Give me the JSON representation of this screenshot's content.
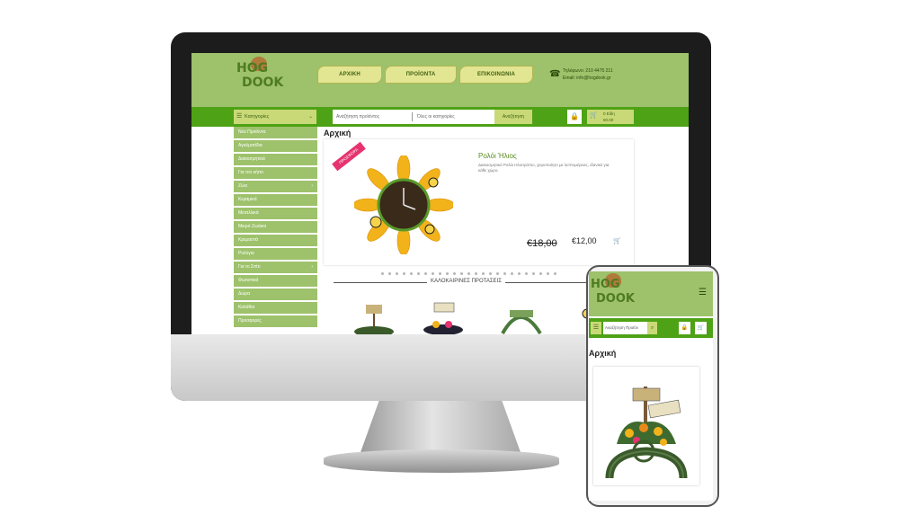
{
  "site": {
    "logo_line1": "HOG",
    "logo_line2": "DOOK",
    "phone_line1": "Τηλέφωνο: 210 4475 211",
    "phone_line2": "Email: info@hogdook.gr"
  },
  "nav": [
    {
      "label": "ΑΡΧΙΚΗ"
    },
    {
      "label": "ΠΡΟΪΟΝΤΑ"
    },
    {
      "label": "ΕΠΙΚΟΙΝΩΝΙΑ"
    }
  ],
  "toolbar": {
    "categories_label": "Κατηγορίες",
    "search_placeholder_1": "Αναζήτηση προϊόντος",
    "search_placeholder_2": "Όλες οι κατηγορίες",
    "search_button": "Αναζήτηση",
    "cart_line1": "0 Είδη",
    "cart_line2": "€0.00"
  },
  "sidebar": {
    "items": [
      {
        "label": "Νέα Προϊόντα",
        "arrow": ""
      },
      {
        "label": "Αγαλματίδια",
        "arrow": ""
      },
      {
        "label": "Διακοσμητικά",
        "arrow": ""
      },
      {
        "label": "Για τον κήπο",
        "arrow": ""
      },
      {
        "label": "Ζώα",
        "arrow": "›"
      },
      {
        "label": "Κεραμικά",
        "arrow": ""
      },
      {
        "label": "Μεταλλικά",
        "arrow": ""
      },
      {
        "label": "Μικρά Ζωάκια",
        "arrow": ""
      },
      {
        "label": "Κρεμαστά",
        "arrow": ""
      },
      {
        "label": "Ρολόγια",
        "arrow": ""
      },
      {
        "label": "Για το Σπίτι",
        "arrow": "›"
      },
      {
        "label": "Φωτιστικά",
        "arrow": ""
      },
      {
        "label": "Δώρα",
        "arrow": ""
      },
      {
        "label": "Καλάθια",
        "arrow": ""
      },
      {
        "label": "Προσφορές",
        "arrow": ""
      }
    ]
  },
  "content": {
    "page_title": "Αρχική",
    "badge": "ΠΡΟΣΦΟΡΑ",
    "product_title": "Ρολόι Ήλιος",
    "product_desc": "Διακοσμητικό Ρολόι Ηλιοτρόπιο, χειροποίητο με λεπτομέρειες, ιδανικό για κάθε χώρο.",
    "old_price": "€18,00",
    "new_price": "€12,00",
    "section_heading": "ΚΑΛΟΚΑΙΡΙΝΕΣ ΠΡΟΤΑΣΕΙΣ"
  },
  "mobile": {
    "menu_icon": "hamburger-icon",
    "search_placeholder": "Αναζήτηση Προϊόν",
    "page_title": "Αρχική"
  },
  "colors": {
    "header_green": "#9dc26b",
    "bar_green": "#4ea215",
    "nav_yellow": "#e2e592",
    "text_green": "#5a8a1f"
  }
}
